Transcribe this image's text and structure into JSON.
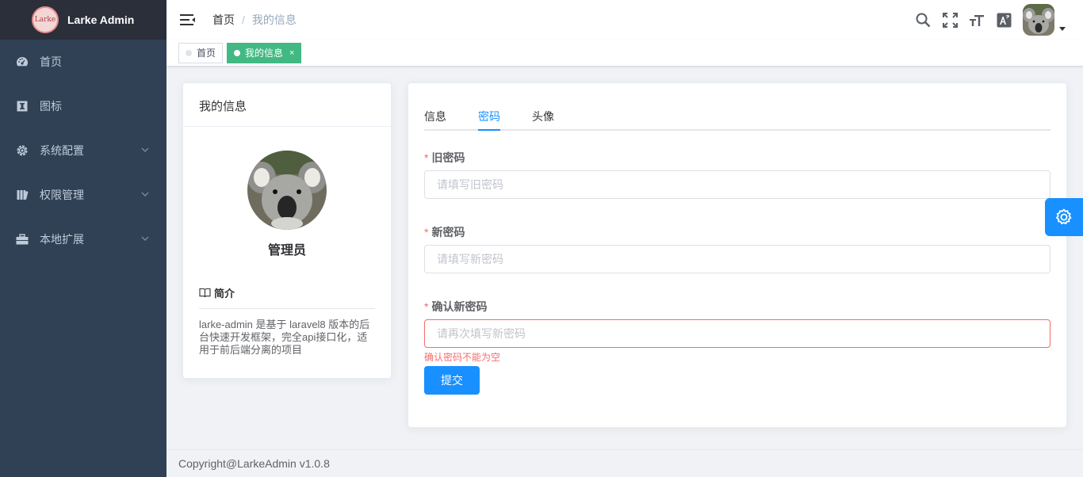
{
  "app": {
    "title": "Larke Admin",
    "logo_text": "Larke"
  },
  "sidebar": {
    "items": [
      {
        "label": "首页",
        "icon": "dashboard-icon",
        "has_children": false
      },
      {
        "label": "图标",
        "icon": "info-icon",
        "has_children": false
      },
      {
        "label": "系统配置",
        "icon": "gear-icon",
        "has_children": true
      },
      {
        "label": "权限管理",
        "icon": "permission-icon",
        "has_children": true
      },
      {
        "label": "本地扩展",
        "icon": "toolbox-icon",
        "has_children": true
      }
    ]
  },
  "header": {
    "breadcrumb": {
      "home": "首页",
      "separator": "/",
      "current": "我的信息"
    },
    "icons": [
      "search-icon",
      "fullscreen-icon",
      "font-size-icon",
      "translate-icon"
    ]
  },
  "tags": [
    {
      "label": "首页",
      "active": false
    },
    {
      "label": "我的信息",
      "active": true,
      "close": "×"
    }
  ],
  "profile": {
    "header": "我的信息",
    "name": "管理员",
    "intro_title": "简介",
    "intro_text": "larke-admin 是基于 laravel8 版本的后台快速开发框架，完全api接口化，适用于前后端分离的项目"
  },
  "form": {
    "tabs": [
      {
        "label": "信息",
        "active": false
      },
      {
        "label": "密码",
        "active": true
      },
      {
        "label": "头像",
        "active": false
      }
    ],
    "fields": [
      {
        "label": "旧密码",
        "required": "*",
        "placeholder": "请填写旧密码",
        "value": ""
      },
      {
        "label": "新密码",
        "required": "*",
        "placeholder": "请填写新密码",
        "value": ""
      },
      {
        "label": "确认新密码",
        "required": "*",
        "placeholder": "请再次填写新密码",
        "value": ""
      }
    ],
    "error": "确认密码不能为空",
    "submit_label": "提交"
  },
  "footer": {
    "copyright": "Copyright@LarkeAdmin v1.0.8"
  },
  "colors": {
    "sidebar_bg": "#304156",
    "logo_bar_bg": "#2b2f3a",
    "primary": "#1890ff",
    "tag_active": "#42b983",
    "error": "#f56c6c"
  }
}
